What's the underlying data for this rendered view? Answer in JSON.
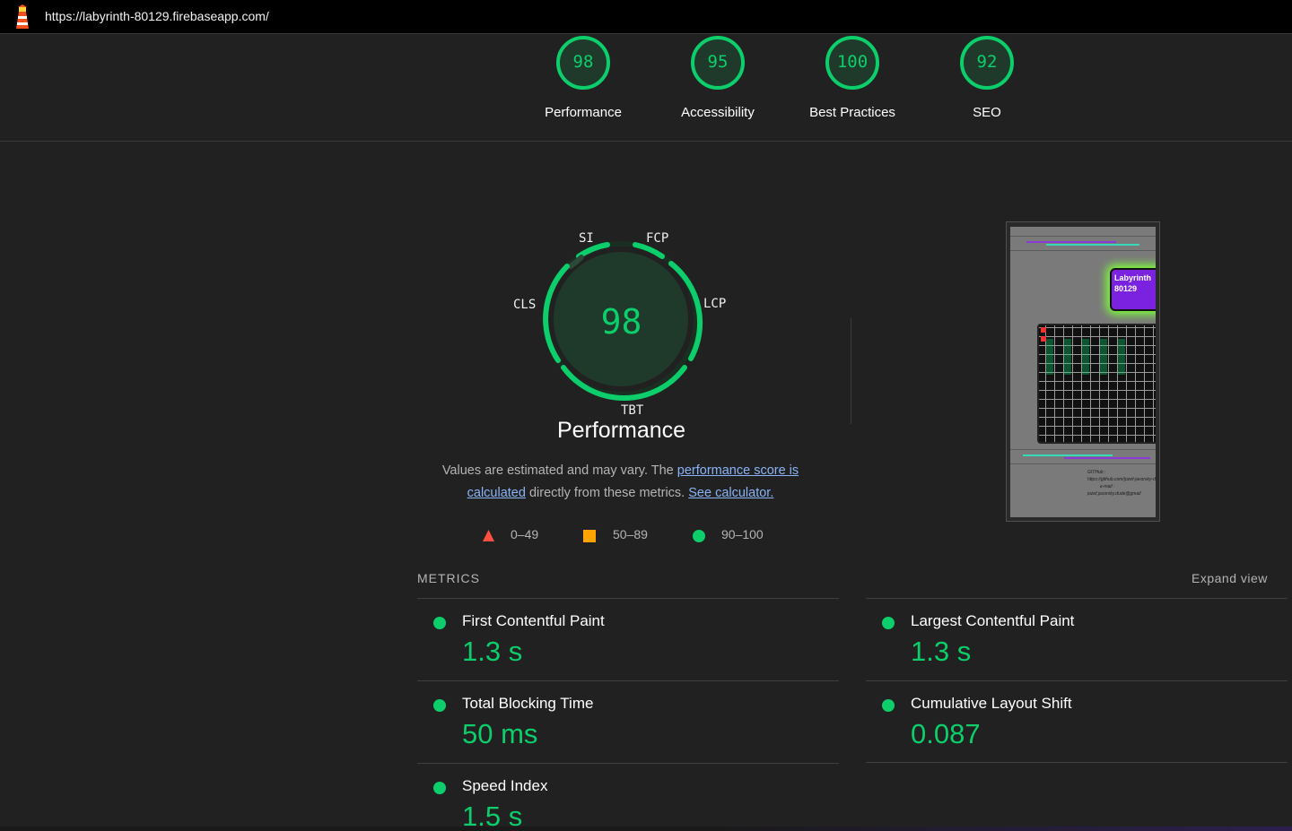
{
  "url": "https://labyrinth-80129.firebaseapp.com/",
  "summary": [
    {
      "score": "98",
      "label": "Performance"
    },
    {
      "score": "95",
      "label": "Accessibility"
    },
    {
      "score": "100",
      "label": "Best Practices"
    },
    {
      "score": "92",
      "label": "SEO"
    }
  ],
  "performance": {
    "score": "98",
    "title": "Performance",
    "metric_labels": {
      "si": "SI",
      "fcp": "FCP",
      "lcp": "LCP",
      "tbt": "TBT",
      "cls": "CLS"
    },
    "desc_prefix": "Values are estimated and may vary. The ",
    "link_score_1": "performance score is",
    "link_score_2": "calculated",
    "desc_middle": " directly from these metrics. ",
    "link_calc": "See calculator."
  },
  "legend": {
    "fail": "0–49",
    "average": "50–89",
    "pass": "90–100"
  },
  "colors": {
    "pass": "#0cce6b",
    "average": "#ffa400",
    "fail": "#ff4e42",
    "link": "#8ab4f8"
  },
  "screenshot": {
    "title_line1": "Labyrinth",
    "title_line2": "80129",
    "github_label": "GITHub :",
    "github_value": "https://github.com/jozef-javorsky-dude",
    "email_label": "e-mail :",
    "email_value": "jozef.javorsky.dude@gmail"
  },
  "metrics": {
    "heading": "METRICS",
    "expand": "Expand view",
    "items": [
      {
        "name": "First Contentful Paint",
        "value": "1.3 s"
      },
      {
        "name": "Largest Contentful Paint",
        "value": "1.3 s"
      },
      {
        "name": "Total Blocking Time",
        "value": "50 ms"
      },
      {
        "name": "Cumulative Layout Shift",
        "value": "0.087"
      },
      {
        "name": "Speed Index",
        "value": "1.5 s"
      }
    ]
  }
}
